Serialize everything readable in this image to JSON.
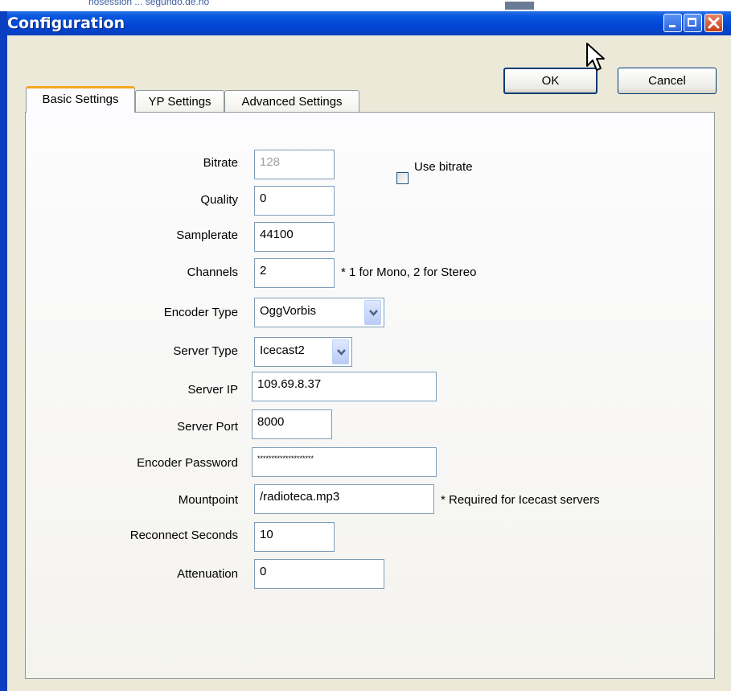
{
  "background_snippet": "nosession ... ségundo.de.no",
  "window": {
    "title": "Configuration"
  },
  "buttons": {
    "ok": "OK",
    "cancel": "Cancel"
  },
  "tabs": [
    {
      "label": "Basic Settings",
      "active": true
    },
    {
      "label": "YP Settings",
      "active": false
    },
    {
      "label": "Advanced Settings",
      "active": false
    }
  ],
  "form": {
    "bitrate": {
      "label": "Bitrate",
      "value": "128",
      "disabled": true
    },
    "use_bitrate": {
      "label": "Use bitrate",
      "checked": false
    },
    "quality": {
      "label": "Quality",
      "value": "0"
    },
    "samplerate": {
      "label": "Samplerate",
      "value": "44100"
    },
    "channels": {
      "label": "Channels",
      "value": "2",
      "note": "* 1 for Mono, 2 for Stereo"
    },
    "encoder_type": {
      "label": "Encoder Type",
      "value": "OggVorbis"
    },
    "server_type": {
      "label": "Server Type",
      "value": "Icecast2"
    },
    "server_ip": {
      "label": "Server IP",
      "value": "109.69.8.37"
    },
    "server_port": {
      "label": "Server Port",
      "value": "8000"
    },
    "encoder_password": {
      "label": "Encoder Password",
      "value": "********************"
    },
    "mountpoint": {
      "label": "Mountpoint",
      "value": "/radioteca.mp3",
      "note": "* Required for Icecast servers"
    },
    "reconnect_seconds": {
      "label": "Reconnect Seconds",
      "value": "10"
    },
    "attenuation": {
      "label": "Attenuation",
      "value": "0"
    }
  },
  "icons": {
    "minimize": "minimize-icon",
    "maximize": "maximize-icon",
    "close": "close-icon",
    "dropdown": "chevron-down-icon",
    "cursor": "mouse-cursor-icon"
  },
  "colors": {
    "titlebar": "#0a58e0",
    "close_button": "#c73b15",
    "active_tab_accent": "#f5a522",
    "field_border": "#7f9db9",
    "dialog_face": "#ece9d8"
  }
}
